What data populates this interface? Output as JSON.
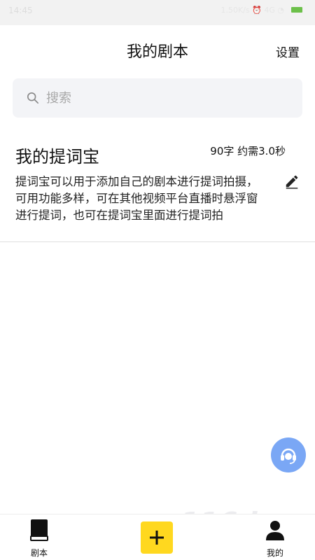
{
  "status": {
    "time": "14:45",
    "indicators": "1.50K/s  ⏰  4G  ◔",
    "battery_color": "#6cc04a"
  },
  "header": {
    "title": "我的剧本",
    "settings_label": "设置"
  },
  "search": {
    "placeholder": "搜索",
    "value": ""
  },
  "scripts": [
    {
      "title": "我的提词宝",
      "meta": "90字  约需3.0秒",
      "body": "提词宝可以用于添加自己的剧本进行提词拍摄，可用功能多样，可在其他视频平台直播时悬浮窗进行提词，也可在提词宝里面进行提词拍"
    }
  ],
  "bottom_nav": {
    "scripts_label": "剧本",
    "mine_label": "我的"
  },
  "watermark": "116d",
  "colors": {
    "accent_yellow": "#ffd81f",
    "fab_blue": "#7aa7f5",
    "search_bg": "#f3f4f7"
  }
}
